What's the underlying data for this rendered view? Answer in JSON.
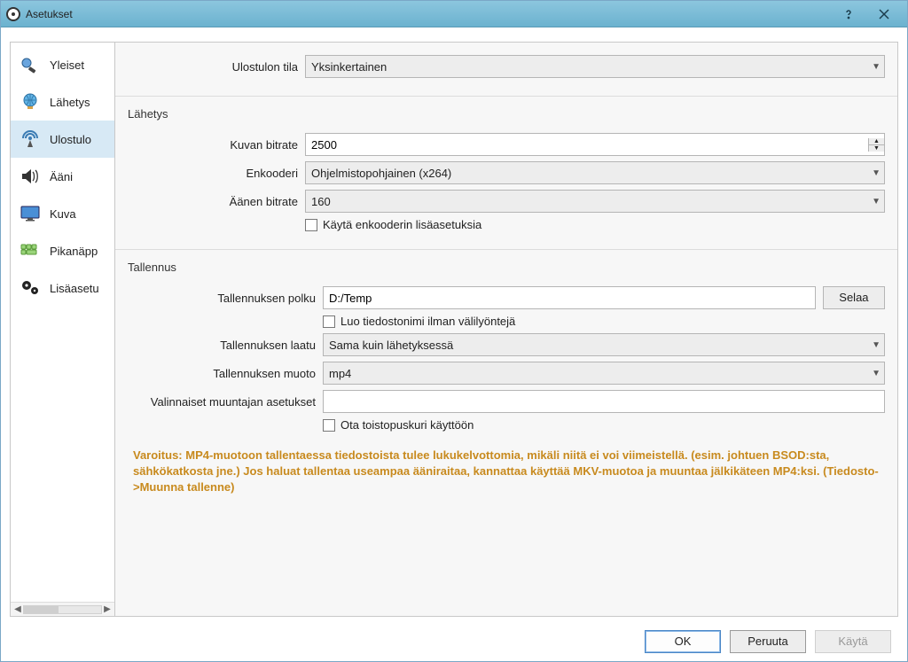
{
  "window": {
    "title": "Asetukset"
  },
  "sidebar": {
    "items": [
      {
        "label": "Yleiset"
      },
      {
        "label": "Lähetys"
      },
      {
        "label": "Ulostulo"
      },
      {
        "label": "Ääni"
      },
      {
        "label": "Kuva"
      },
      {
        "label": "Pikanäpp"
      },
      {
        "label": "Lisäasetu"
      }
    ]
  },
  "output": {
    "mode_label": "Ulostulon tila",
    "mode_value": "Yksinkertainen"
  },
  "stream": {
    "title": "Lähetys",
    "bitrate_label": "Kuvan bitrate",
    "bitrate_value": "2500",
    "encoder_label": "Enkooderi",
    "encoder_value": "Ohjelmistopohjainen (x264)",
    "audio_bitrate_label": "Äänen bitrate",
    "audio_bitrate_value": "160",
    "advanced_checkbox": "Käytä enkooderin lisäasetuksia"
  },
  "recording": {
    "title": "Tallennus",
    "path_label": "Tallennuksen polku",
    "path_value": "D:/Temp",
    "browse": "Selaa",
    "nospace_checkbox": "Luo tiedostonimi ilman välilyöntejä",
    "quality_label": "Tallennuksen laatu",
    "quality_value": "Sama kuin lähetyksessä",
    "format_label": "Tallennuksen muoto",
    "format_value": "mp4",
    "muxer_label": "Valinnaiset muuntajan asetukset",
    "muxer_value": "",
    "replay_checkbox": "Ota toistopuskuri käyttöön"
  },
  "warning": "Varoitus: MP4-muotoon tallentaessa tiedostoista tulee lukukelvottomia, mikäli niitä ei voi viimeistellä. (esim. johtuen BSOD:sta, sähkökatkosta jne.) Jos haluat tallentaa useampaa ääniraitaa, kannattaa käyttää MKV-muotoa ja muuntaa jälkikäteen MP4:ksi. (Tiedosto->Muunna tallenne)",
  "buttons": {
    "ok": "OK",
    "cancel": "Peruuta",
    "apply": "Käytä"
  }
}
